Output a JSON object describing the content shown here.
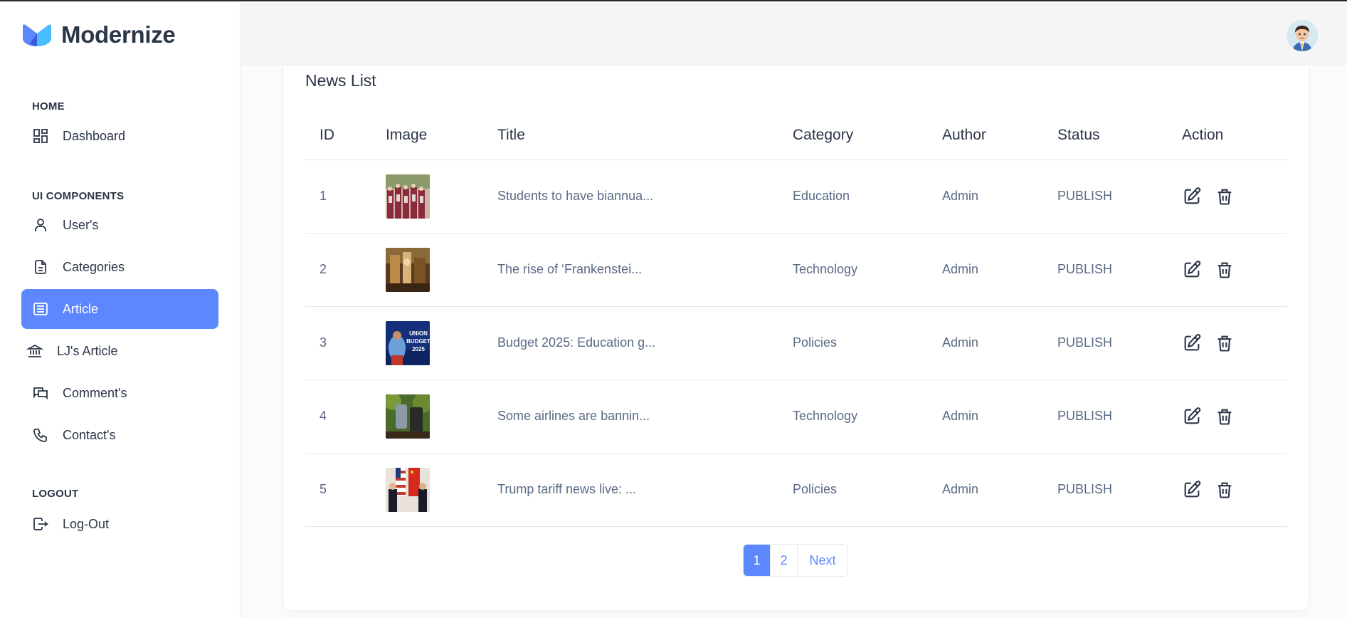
{
  "brand": {
    "name": "Modernize"
  },
  "colors": {
    "accent": "#5d87ff",
    "text": "#2a3547",
    "muted": "#5a6a85"
  },
  "sidebar": {
    "sections": [
      {
        "label": "HOME"
      },
      {
        "label": "UI COMPONENTS"
      },
      {
        "label": "LOGOUT"
      }
    ],
    "items": [
      {
        "label": "Dashboard",
        "icon": "dashboard-icon"
      },
      {
        "label": "User's",
        "icon": "user-icon"
      },
      {
        "label": "Categories",
        "icon": "file-icon"
      },
      {
        "label": "Article",
        "icon": "article-icon",
        "active": true
      },
      {
        "label": "LJ's Article",
        "icon": "bank-icon"
      },
      {
        "label": "Comment's",
        "icon": "messages-icon"
      },
      {
        "label": "Contact's",
        "icon": "phone-icon"
      },
      {
        "label": "Log-Out",
        "icon": "logout-icon"
      }
    ]
  },
  "header": {
    "avatar": "user-avatar"
  },
  "news": {
    "title": "News List",
    "columns": [
      "ID",
      "Image",
      "Title",
      "Category",
      "Author",
      "Status",
      "Action"
    ],
    "rows": [
      {
        "id": "1",
        "title": "Students to have biannua...",
        "category": "Education",
        "author": "Admin",
        "status": "PUBLISH",
        "image": "students-photo"
      },
      {
        "id": "2",
        "title": "The rise of ‘Frankenstei...",
        "category": "Technology",
        "author": "Admin",
        "status": "PUBLISH",
        "image": "workshop-photo"
      },
      {
        "id": "3",
        "title": "Budget 2025: Education g...",
        "category": "Policies",
        "author": "Admin",
        "status": "PUBLISH",
        "image": "union-budget-photo",
        "image_text": [
          "UNION",
          "BUDGET",
          "2025"
        ]
      },
      {
        "id": "4",
        "title": "Some airlines are bannin...",
        "category": "Technology",
        "author": "Admin",
        "status": "PUBLISH",
        "image": "powerbank-photo"
      },
      {
        "id": "5",
        "title": "Trump tariff news live: ...",
        "category": "Policies",
        "author": "Admin",
        "status": "PUBLISH",
        "image": "flags-photo"
      }
    ]
  },
  "pagination": {
    "pages": [
      "1",
      "2"
    ],
    "current": "1",
    "next_label": "Next"
  }
}
